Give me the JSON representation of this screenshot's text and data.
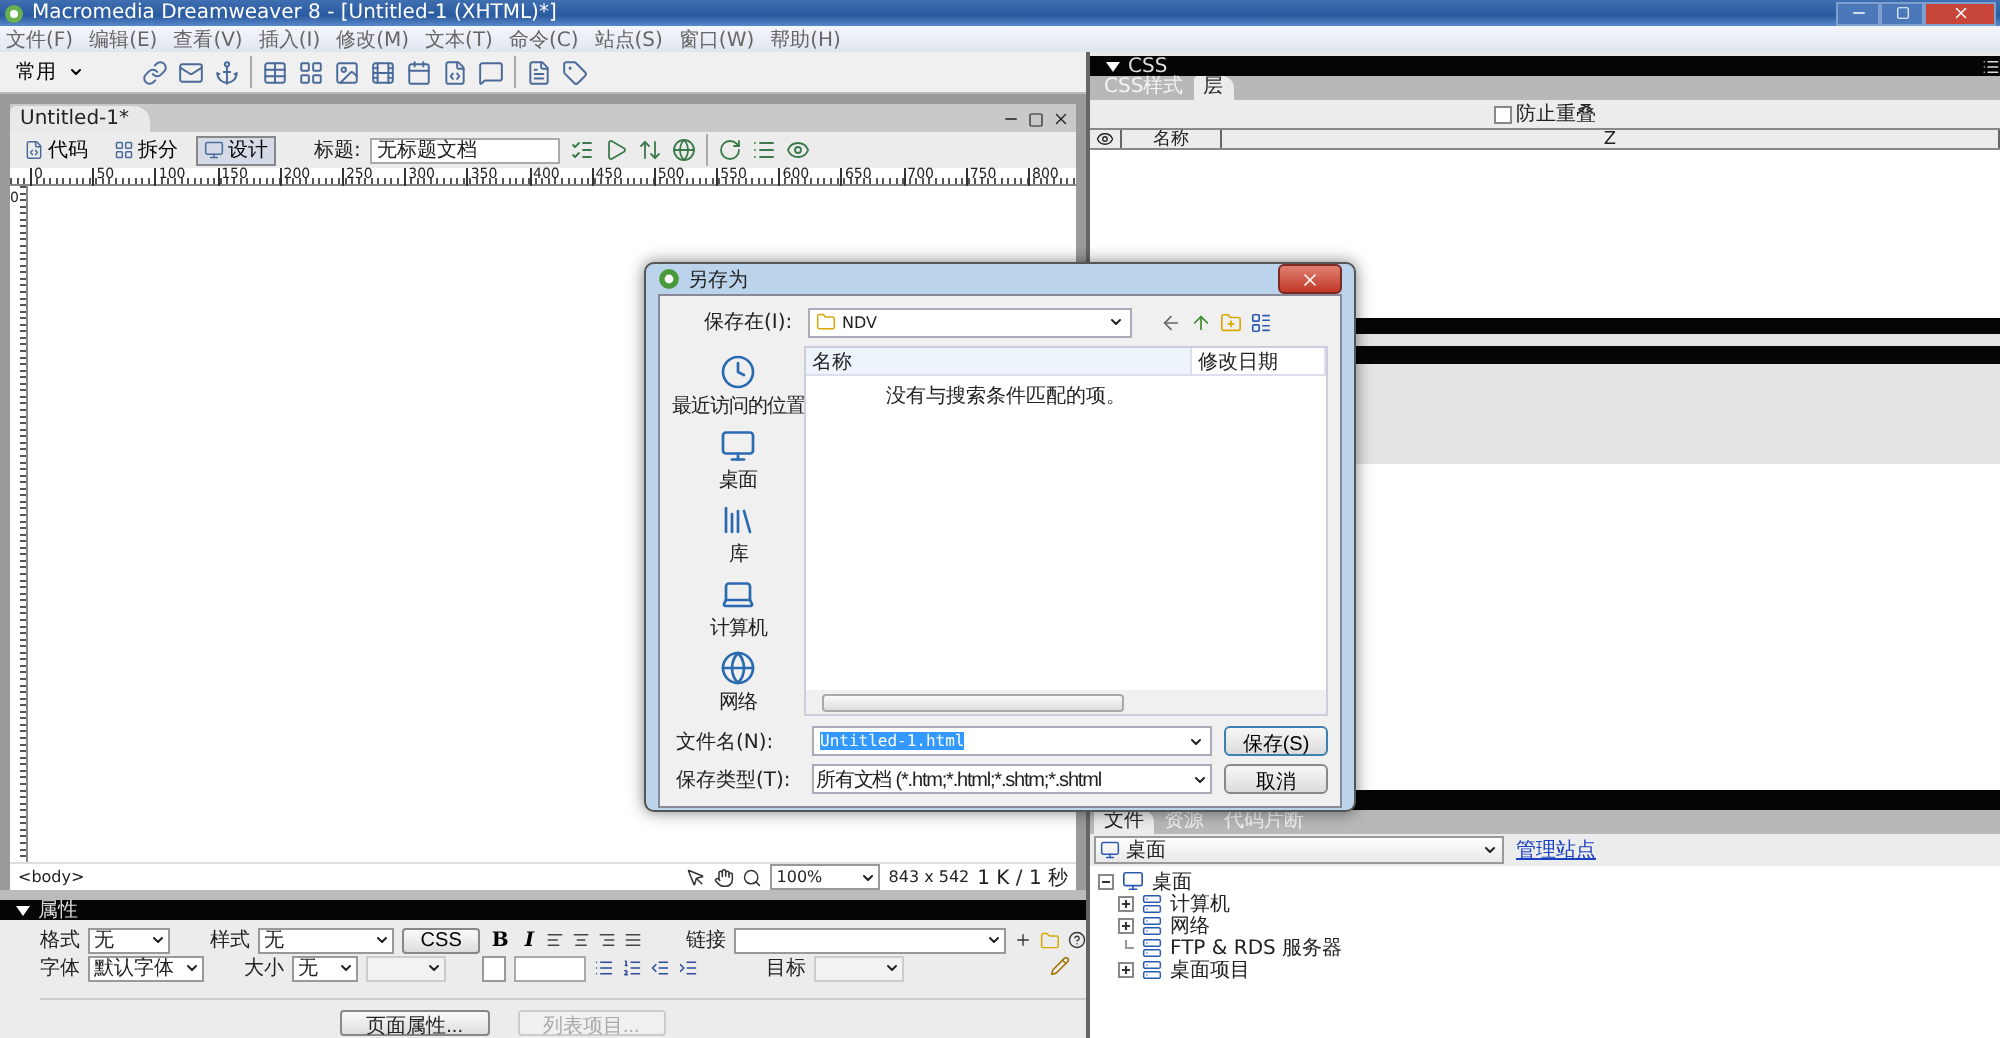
{
  "window": {
    "title": "Macromedia Dreamweaver 8 - [Untitled-1 (XHTML)*]"
  },
  "menu": [
    "文件(F)",
    "编辑(E)",
    "查看(V)",
    "插入(I)",
    "修改(M)",
    "文本(T)",
    "命令(C)",
    "站点(S)",
    "窗口(W)",
    "帮助(H)"
  ],
  "insert_bar": {
    "category": "常用"
  },
  "document": {
    "tab": "Untitled-1*",
    "view_buttons": [
      {
        "label": "代码",
        "selected": false
      },
      {
        "label": "拆分",
        "selected": false
      },
      {
        "label": "设计",
        "selected": true
      }
    ],
    "title_label": "标题:",
    "title_value": "无标题文档",
    "ruler_ticks": [
      "0",
      "50",
      "100",
      "150",
      "200",
      "250",
      "300",
      "350",
      "400",
      "450",
      "500",
      "550",
      "600",
      "650",
      "700",
      "750",
      "800"
    ],
    "ruler_origin": "0",
    "tag_selector": "<body>",
    "zoom": "100%",
    "size": "843 x 542",
    "download": "1 K / 1 秒"
  },
  "properties": {
    "title": "属性",
    "format_label": "格式",
    "format": "无",
    "style_label": "样式",
    "style": "无",
    "css_button": "CSS",
    "bold": "B",
    "italic": "I",
    "link_label": "链接",
    "font_label": "字体",
    "font": "默认字体",
    "size_label": "大小",
    "size": "无",
    "target_label": "目标",
    "buttons": [
      {
        "label": "页面属性...",
        "disabled": false
      },
      {
        "label": "列表项目...",
        "disabled": true
      }
    ]
  },
  "css_panel": {
    "title": "CSS",
    "tabs": [
      {
        "label": "CSS样式",
        "selected": false
      },
      {
        "label": "层",
        "selected": true
      }
    ],
    "prevent_overlap": {
      "label": "防止重叠",
      "checked": false
    },
    "columns": [
      "名称",
      "Z"
    ]
  },
  "files_panel": {
    "tabs": [
      {
        "label": "文件",
        "selected": true
      },
      {
        "label": "资源",
        "selected": false
      },
      {
        "label": "代码片断",
        "selected": false
      }
    ],
    "location": "桌面",
    "manage_link": "管理站点",
    "tree": [
      {
        "label": "桌面",
        "expanded": true,
        "children": [
          {
            "label": "计算机",
            "expanded": false
          },
          {
            "label": "网络",
            "expanded": false
          },
          {
            "label": "FTP & RDS 服务器"
          },
          {
            "label": "桌面项目",
            "expanded": false
          }
        ]
      }
    ]
  },
  "dialog": {
    "title": "另存为",
    "save_in_label": "保存在(I):",
    "save_in": "NDV",
    "places": [
      "最近访问的位置",
      "桌面",
      "库",
      "计算机",
      "网络"
    ],
    "columns": [
      "名称",
      "修改日期"
    ],
    "empty_message": "没有与搜索条件匹配的项。",
    "filename_label": "文件名(N):",
    "filename": "Untitled-1.html",
    "filetype_label": "保存类型(T):",
    "filetype": "所有文档 (*.htm;*.html;*.shtm;*.shtml",
    "buttons": [
      "保存(S)",
      "取消"
    ]
  }
}
